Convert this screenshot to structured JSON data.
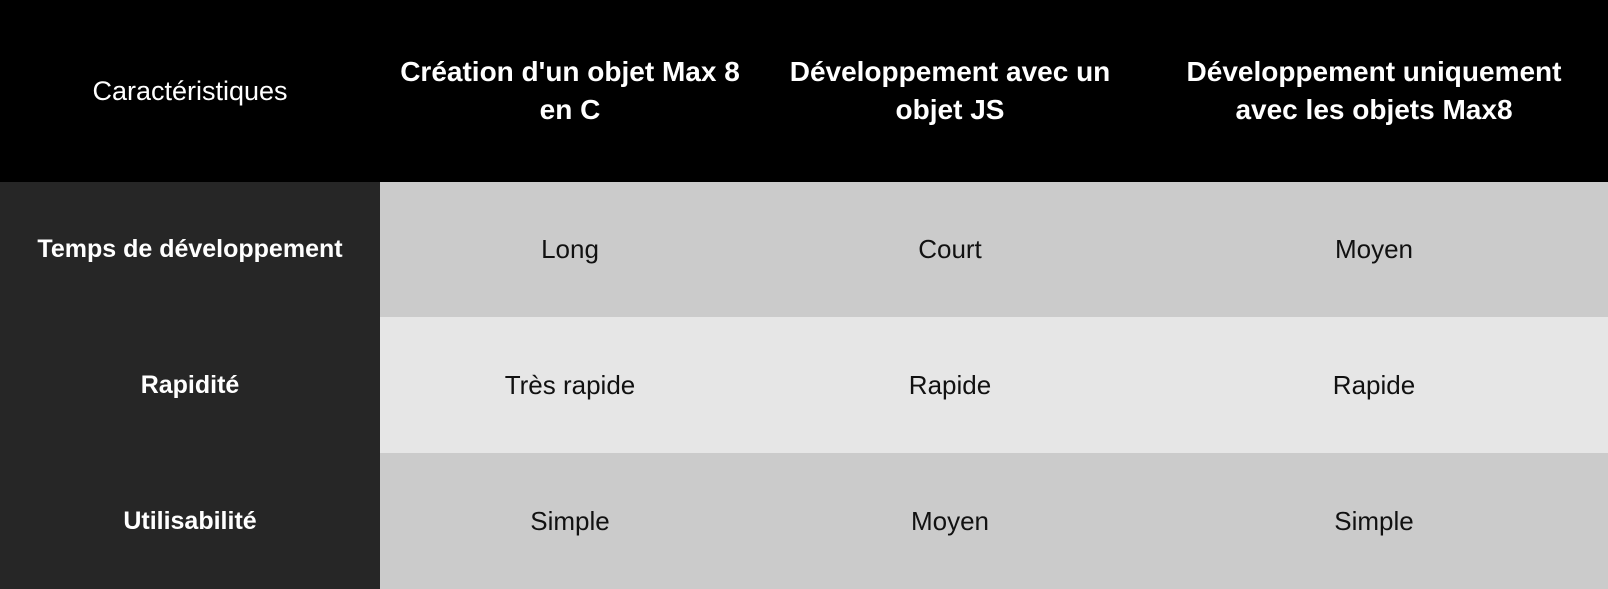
{
  "table": {
    "headers": [
      "Caractéristiques",
      "Création d'un objet Max 8 en C",
      "Développement avec un objet JS",
      "Développement uniquement avec les objets Max8"
    ],
    "rows": [
      {
        "label": "Temps de développement",
        "cells": [
          "Long",
          "Court",
          "Moyen"
        ]
      },
      {
        "label": "Rapidité",
        "cells": [
          "Très rapide",
          "Rapide",
          "Rapide"
        ]
      },
      {
        "label": "Utilisabilité",
        "cells": [
          "Simple",
          "Moyen",
          "Simple"
        ]
      }
    ]
  },
  "colors": {
    "header_bg": "#000000",
    "rowhead_bg": "#262626",
    "row_dark_bg": "#cbcbcb",
    "row_light_bg": "#e6e6e6"
  }
}
